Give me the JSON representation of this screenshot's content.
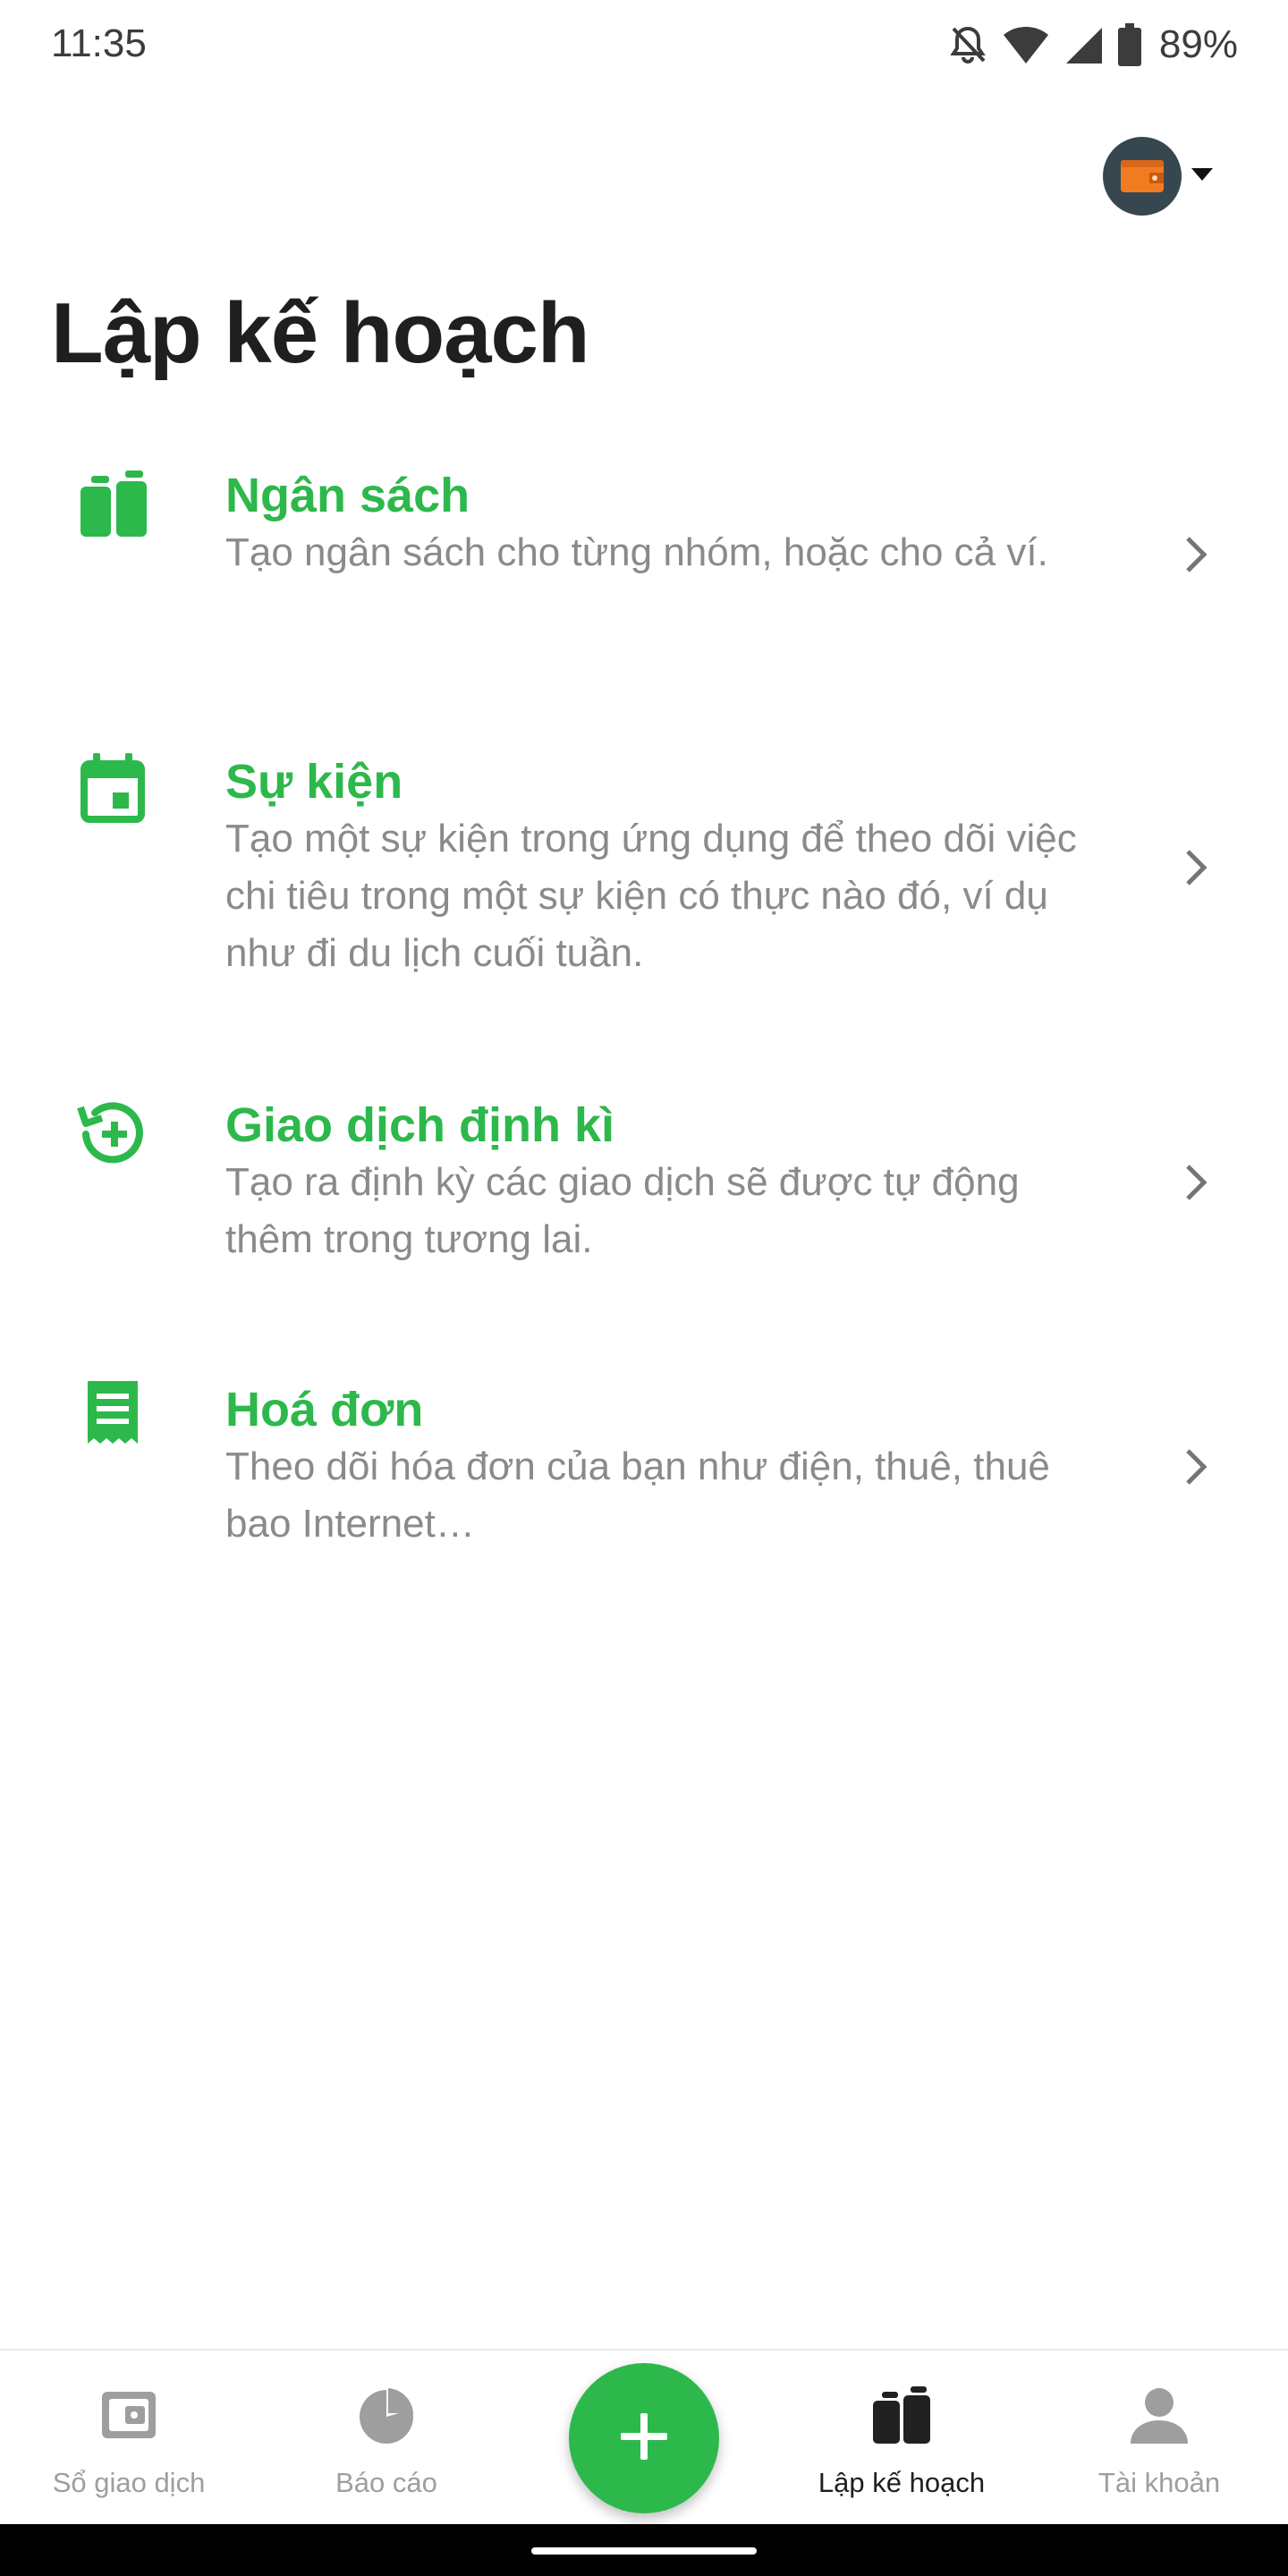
{
  "status_bar": {
    "time": "11:35",
    "battery": "89%",
    "icons": [
      "bell-off-icon",
      "wifi-icon",
      "signal-icon",
      "battery-icon"
    ]
  },
  "header": {
    "wallet_icon": "wallet-icon",
    "dropdown_icon": "caret-down-icon"
  },
  "page": {
    "title": "Lập kế hoạch"
  },
  "menu": [
    {
      "icon": "budget-icon",
      "title": "Ngân sách",
      "description": "Tạo ngân sách cho từng nhóm, hoặc cho cả ví."
    },
    {
      "icon": "calendar-event-icon",
      "title": "Sự kiện",
      "description": "Tạo một sự kiện trong ứng dụng để theo dõi việc chi tiêu trong một sự kiện có thực nào đó, ví dụ như đi du lịch cuối tuần."
    },
    {
      "icon": "recurring-add-icon",
      "title": "Giao dịch định kì",
      "description": "Tạo ra định kỳ các giao dịch sẽ được tự động thêm trong tương lai."
    },
    {
      "icon": "receipt-icon",
      "title": "Hoá đơn",
      "description": "Theo dõi hóa đơn của bạn như điện, thuê, thuê bao Internet…"
    }
  ],
  "bottom_nav": {
    "items": [
      {
        "label": "Sổ giao dịch",
        "icon": "wallet-book-icon",
        "active": false
      },
      {
        "label": "Báo cáo",
        "icon": "pie-chart-icon",
        "active": false
      },
      {
        "label": "Lập kế hoạch",
        "icon": "planning-icon",
        "active": true
      },
      {
        "label": "Tài khoản",
        "icon": "account-icon",
        "active": false
      }
    ],
    "fab_icon": "plus-icon"
  },
  "colors": {
    "accent": "#2db84c",
    "title": "#1f1f1f",
    "description": "#8a8a8a",
    "nav_inactive": "#9e9e9e",
    "wallet_orange": "#f07c1f"
  }
}
